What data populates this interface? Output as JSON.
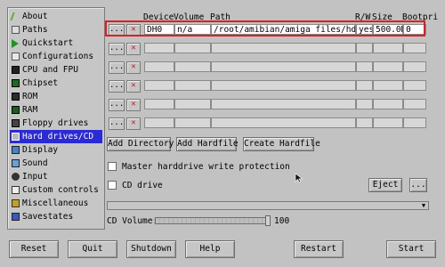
{
  "colors": {
    "window_bg": "#c2c2c2",
    "nav_active": "#2a2ad6",
    "highlight_border": "#e01e1e"
  },
  "sidebar": {
    "items": [
      {
        "label": "About",
        "icon": "about-icon"
      },
      {
        "label": "Paths",
        "icon": "paths-icon"
      },
      {
        "label": "Quickstart",
        "icon": "quickstart-icon"
      },
      {
        "label": "Configurations",
        "icon": "configurations-icon"
      },
      {
        "label": "CPU and FPU",
        "icon": "cpu-icon"
      },
      {
        "label": "Chipset",
        "icon": "chipset-icon"
      },
      {
        "label": "ROM",
        "icon": "rom-icon"
      },
      {
        "label": "RAM",
        "icon": "ram-icon"
      },
      {
        "label": "Floppy drives",
        "icon": "floppy-icon"
      },
      {
        "label": "Hard drives/CD",
        "icon": "harddrive-icon",
        "active": true
      },
      {
        "label": "Display",
        "icon": "display-icon"
      },
      {
        "label": "Sound",
        "icon": "sound-icon"
      },
      {
        "label": "Input",
        "icon": "input-icon"
      },
      {
        "label": "Custom controls",
        "icon": "custom-controls-icon"
      },
      {
        "label": "Miscellaneous",
        "icon": "misc-icon"
      },
      {
        "label": "Savestates",
        "icon": "savestates-icon"
      }
    ]
  },
  "table": {
    "headers": {
      "device": "Device",
      "volume": "Volume",
      "path": "Path",
      "rw": "R/W",
      "size": "Size",
      "bootpri": "Bootpri"
    },
    "rows": [
      {
        "device": "DH0",
        "volume": "n/a",
        "path": "/root/amibian/amiga_files/hdd/hd",
        "rw": "yes",
        "size": "500.0M",
        "bootpri": "0"
      },
      {
        "device": "",
        "volume": "",
        "path": "",
        "rw": "",
        "size": "",
        "bootpri": ""
      },
      {
        "device": "",
        "volume": "",
        "path": "",
        "rw": "",
        "size": "",
        "bootpri": ""
      },
      {
        "device": "",
        "volume": "",
        "path": "",
        "rw": "",
        "size": "",
        "bootpri": ""
      },
      {
        "device": "",
        "volume": "",
        "path": "",
        "rw": "",
        "size": "",
        "bootpri": ""
      },
      {
        "device": "",
        "volume": "",
        "path": "",
        "rw": "",
        "size": "",
        "bootpri": ""
      }
    ],
    "row_button_label": "...",
    "row_delete_label": "✕"
  },
  "actions": {
    "add_directory": "Add Directory",
    "add_hardfile": "Add Hardfile",
    "create_hardfile": "Create Hardfile"
  },
  "options": {
    "master_protection": "Master harddrive write protection",
    "cd_drive": "CD drive",
    "eject": "Eject",
    "cd_browse": "...",
    "cd_volume_label": "CD Volume:",
    "cd_volume_value": "100",
    "cd_volume_fraction": 1.0
  },
  "bottom": {
    "reset": "Reset",
    "quit": "Quit",
    "shutdown": "Shutdown",
    "help": "Help",
    "restart": "Restart",
    "start": "Start"
  }
}
